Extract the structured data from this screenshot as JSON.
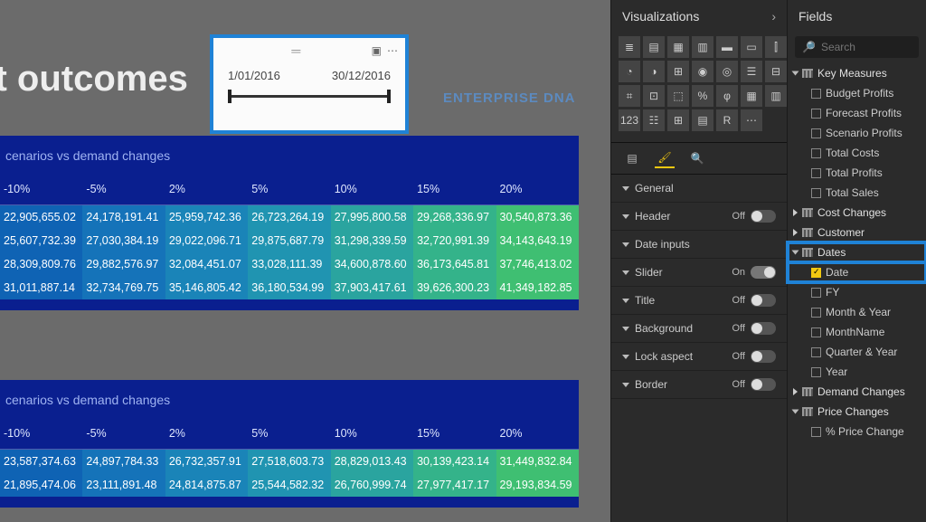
{
  "report": {
    "title": "est outcomes",
    "brand": "ENTERPRISE DNA"
  },
  "date_slicer": {
    "from": "1/01/2016",
    "to": "30/12/2016"
  },
  "matrix1": {
    "title": "cenarios vs demand changes",
    "headers": [
      "-10%",
      "-5%",
      "2%",
      "5%",
      "10%",
      "15%",
      "20%"
    ],
    "rows": [
      [
        "22,905,655.02",
        "24,178,191.41",
        "25,959,742.36",
        "26,723,264.19",
        "27,995,800.58",
        "29,268,336.97",
        "30,540,873.36"
      ],
      [
        "25,607,732.39",
        "27,030,384.19",
        "29,022,096.71",
        "29,875,687.79",
        "31,298,339.59",
        "32,720,991.39",
        "34,143,643.19"
      ],
      [
        "28,309,809.76",
        "29,882,576.97",
        "32,084,451.07",
        "33,028,111.39",
        "34,600,878.60",
        "36,173,645.81",
        "37,746,413.02"
      ],
      [
        "31,011,887.14",
        "32,734,769.75",
        "35,146,805.42",
        "36,180,534.99",
        "37,903,417.61",
        "39,626,300.23",
        "41,349,182.85"
      ]
    ]
  },
  "matrix2": {
    "title": "cenarios vs demand changes",
    "headers": [
      "-10%",
      "-5%",
      "2%",
      "5%",
      "10%",
      "15%",
      "20%"
    ],
    "rows": [
      [
        "23,587,374.63",
        "24,897,784.33",
        "26,732,357.91",
        "27,518,603.73",
        "28,829,013.43",
        "30,139,423.14",
        "31,449,832.84"
      ],
      [
        "21,895,474.06",
        "23,111,891.48",
        "24,814,875.87",
        "25,544,582.32",
        "26,760,999.74",
        "27,977,417.17",
        "29,193,834.59"
      ]
    ]
  },
  "viz_pane": {
    "title": "Visualizations",
    "props": [
      {
        "name": "General",
        "toggle": null
      },
      {
        "name": "Header",
        "toggle": "Off"
      },
      {
        "name": "Date inputs",
        "toggle": null
      },
      {
        "name": "Slider",
        "toggle": "On"
      },
      {
        "name": "Title",
        "toggle": "Off"
      },
      {
        "name": "Background",
        "toggle": "Off"
      },
      {
        "name": "Lock aspect",
        "toggle": "Off"
      },
      {
        "name": "Border",
        "toggle": "Off"
      }
    ]
  },
  "fields_pane": {
    "title": "Fields",
    "search_placeholder": "Search",
    "tables": [
      {
        "name": "Key Measures",
        "expanded": true,
        "fields": [
          {
            "name": "Budget Profits"
          },
          {
            "name": "Forecast Profits"
          },
          {
            "name": "Scenario Profits"
          },
          {
            "name": "Total Costs"
          },
          {
            "name": "Total Profits"
          },
          {
            "name": "Total Sales"
          }
        ]
      },
      {
        "name": "Cost Changes",
        "expanded": false
      },
      {
        "name": "Customer",
        "expanded": false
      },
      {
        "name": "Dates",
        "expanded": true,
        "highlight": true,
        "fields": [
          {
            "name": "Date",
            "checked": true,
            "highlight": true
          },
          {
            "name": "FY"
          },
          {
            "name": "Month & Year"
          },
          {
            "name": "MonthName"
          },
          {
            "name": "Quarter & Year"
          },
          {
            "name": "Year"
          }
        ]
      },
      {
        "name": "Demand Changes",
        "expanded": false
      },
      {
        "name": "Price Changes",
        "expanded": true,
        "fields": [
          {
            "name": "% Price Change"
          }
        ]
      }
    ]
  }
}
